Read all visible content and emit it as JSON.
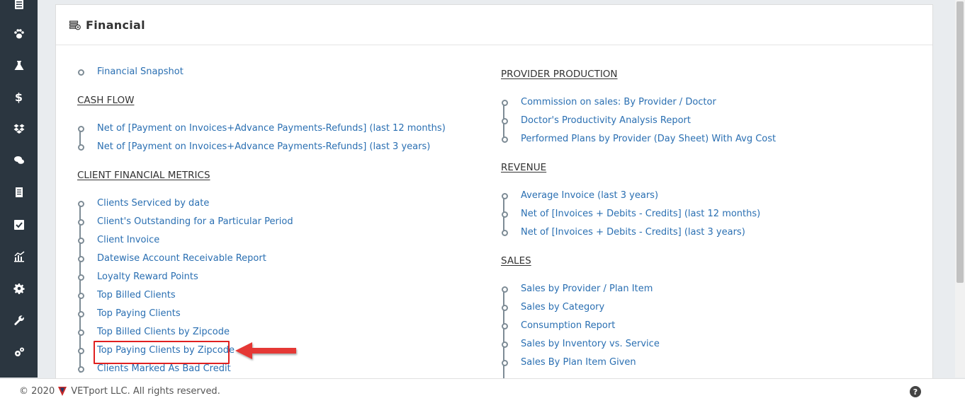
{
  "sidebar": {
    "icons": [
      "list-icon",
      "paw-icon",
      "flask-icon",
      "dollar-icon",
      "dropbox-icon",
      "chat-icon",
      "receipt-icon",
      "checkbox-icon",
      "chart-icon",
      "gear-icon",
      "wrench-icon",
      "gears-icon"
    ]
  },
  "panel": {
    "title": "Financial",
    "icon": "money-icon"
  },
  "left": {
    "top_link": "Financial Snapshot",
    "cash_flow": {
      "heading": "CASH FLOW",
      "items": [
        "Net of [Payment on Invoices+Advance Payments-Refunds] (last 12 months)",
        "Net of [Payment on Invoices+Advance Payments-Refunds] (last 3 years)"
      ]
    },
    "client_metrics": {
      "heading": "CLIENT FINANCIAL METRICS",
      "items": [
        "Clients Serviced by date",
        "Client's Outstanding for a Particular Period",
        "Client Invoice",
        "Datewise Account Receivable Report",
        "Loyalty Reward Points",
        "Top Billed Clients",
        "Top Paying Clients",
        "Top Billed Clients by Zipcode",
        "Top Paying Clients by Zipcode",
        "Clients Marked As Bad Credit"
      ]
    }
  },
  "right": {
    "provider_production": {
      "heading": "PROVIDER PRODUCTION",
      "items": [
        "Commission on sales: By Provider / Doctor",
        "Doctor's Productivity Analysis Report",
        "Performed Plans by Provider (Day Sheet) With Avg Cost"
      ]
    },
    "revenue": {
      "heading": "REVENUE",
      "items": [
        "Average Invoice (last 3 years)",
        "Net of [Invoices + Debits - Credits] (last 12 months)",
        "Net of [Invoices + Debits - Credits] (last 3 years)"
      ]
    },
    "sales": {
      "heading": "SALES",
      "items": [
        "Sales by Provider / Plan Item",
        "Sales by Category",
        "Consumption Report",
        "Sales by Inventory vs. Service",
        "Sales By Plan Item Given"
      ]
    }
  },
  "highlighted_item": "Top Paying Clients by Zipcode",
  "colors": {
    "link": "#2a6fb2",
    "highlight": "#e02020",
    "sidebar": "#2b3640"
  },
  "footer": {
    "copyright": "© 2020",
    "company": "VETport LLC. All rights reserved.",
    "help": "?"
  }
}
